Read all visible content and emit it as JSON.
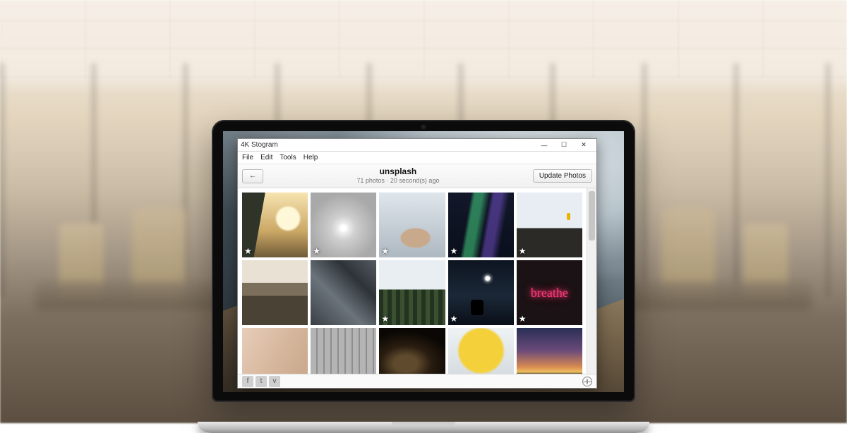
{
  "app": {
    "window_title": "4K Stogram",
    "window_controls": {
      "min": "—",
      "max": "☐",
      "close": "✕"
    },
    "menubar": [
      "File",
      "Edit",
      "Tools",
      "Help"
    ],
    "toolbar": {
      "back_icon": "←",
      "title": "unsplash",
      "subtitle": "71 photos · 20 second(s) ago",
      "update_label": "Update Photos"
    },
    "grid": {
      "star_glyph": "★",
      "thumbs": [
        {
          "name": "tree-sun",
          "starred": true
        },
        {
          "name": "tunnel",
          "starred": true
        },
        {
          "name": "hand",
          "starred": true
        },
        {
          "name": "aurora",
          "starred": true
        },
        {
          "name": "cliff",
          "starred": true
        },
        {
          "name": "valley",
          "starred": false
        },
        {
          "name": "rock",
          "starred": false
        },
        {
          "name": "pines",
          "starred": true
        },
        {
          "name": "moon",
          "starred": true
        },
        {
          "name": "breathe",
          "starred": true
        },
        {
          "name": "skin",
          "starred": false
        },
        {
          "name": "building",
          "starred": false
        },
        {
          "name": "galaxy",
          "starred": false
        },
        {
          "name": "autumn",
          "starred": false
        },
        {
          "name": "dusk",
          "starred": false
        }
      ]
    },
    "statusbar": {
      "social": [
        {
          "name": "facebook-icon",
          "glyph": "f"
        },
        {
          "name": "twitter-icon",
          "glyph": "t"
        },
        {
          "name": "vimeo-icon",
          "glyph": "v"
        }
      ]
    }
  }
}
